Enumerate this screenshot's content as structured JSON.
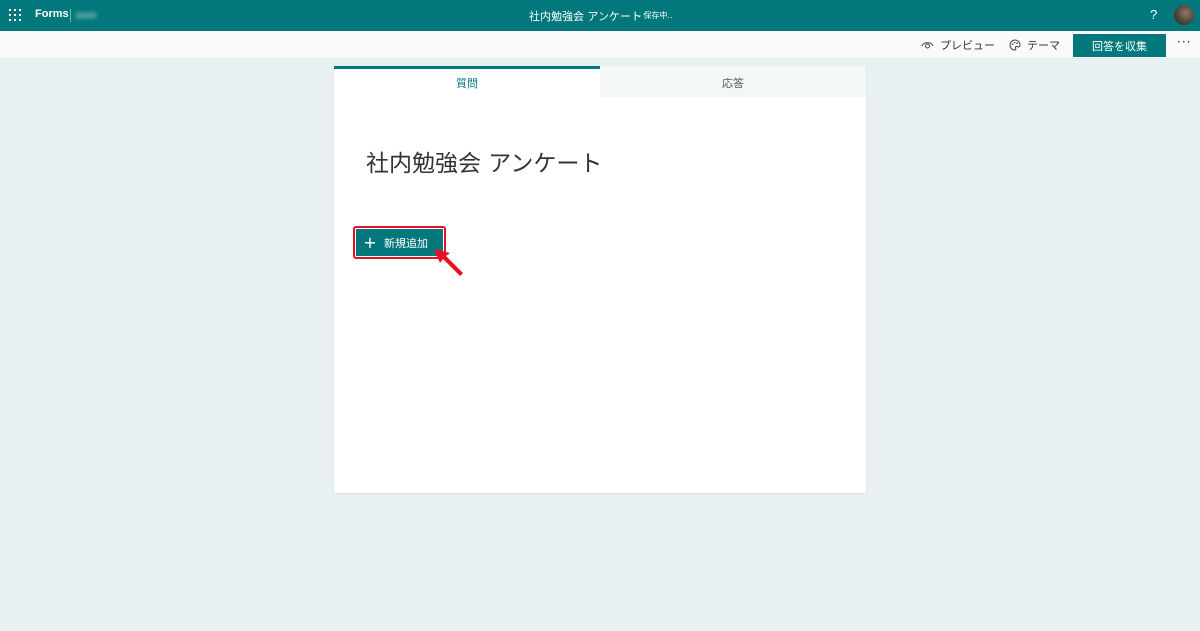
{
  "topbar": {
    "app_name": "Forms",
    "doc_title": "社内勉強会 アンケート",
    "save_status": "- 保存中..",
    "help_label": "?"
  },
  "toolbar": {
    "preview_label": "プレビュー",
    "theme_label": "テーマ",
    "collect_label": "回答を収集",
    "more_label": "···"
  },
  "tabs": [
    {
      "label": "質問"
    },
    {
      "label": "応答"
    }
  ],
  "form": {
    "title": "社内勉強会 アンケート",
    "add_new_label": "新規追加"
  },
  "colors": {
    "brand": "#03787c",
    "annotation": "#e81123",
    "background": "#e8f0f2"
  },
  "icons": [
    "waffle-icon",
    "eye-icon",
    "palette-icon",
    "plus-icon",
    "arrow-annotation-icon"
  ]
}
